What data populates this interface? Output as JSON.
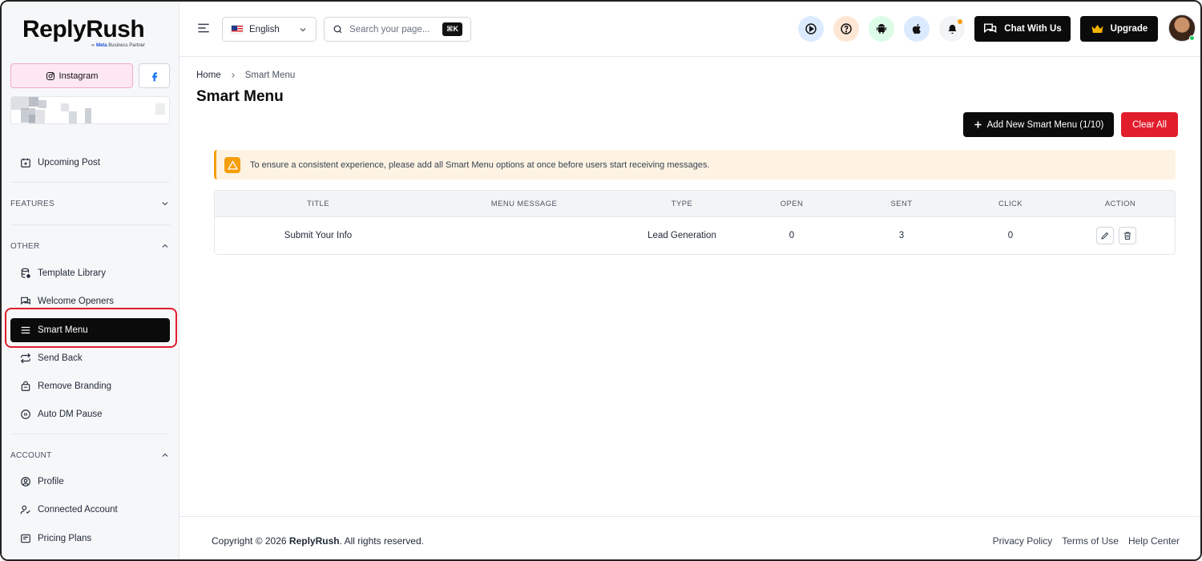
{
  "brand": {
    "name": "ReplyRush",
    "sub_prefix": "Meta",
    "sub_text": "Business Partner"
  },
  "sidebar": {
    "platforms": {
      "instagram": "Instagram",
      "facebook": "f"
    },
    "upcoming": "Upcoming Post",
    "sections": {
      "features": "FEATURES",
      "other": "OTHER",
      "account": "ACCOUNT"
    },
    "other_items": [
      {
        "label": "Template Library",
        "icon": "database-icon"
      },
      {
        "label": "Welcome Openers",
        "icon": "chat-icon"
      },
      {
        "label": "Smart Menu",
        "icon": "menu-icon",
        "active": true
      },
      {
        "label": "Send Back",
        "icon": "repeat-icon"
      },
      {
        "label": "Remove Branding",
        "icon": "bag-icon"
      },
      {
        "label": "Auto DM Pause",
        "icon": "pause-icon"
      }
    ],
    "account_items": [
      {
        "label": "Profile",
        "icon": "user-circle-icon"
      },
      {
        "label": "Connected Account",
        "icon": "user-check-icon"
      },
      {
        "label": "Pricing Plans",
        "icon": "tag-icon"
      }
    ]
  },
  "header": {
    "language": "English",
    "search_placeholder": "Search your page...",
    "search_shortcut": "⌘K",
    "chat_label": "Chat With Us",
    "upgrade_label": "Upgrade"
  },
  "main": {
    "breadcrumb": {
      "home": "Home",
      "current": "Smart Menu"
    },
    "title": "Smart Menu",
    "add_button": "Add New Smart Menu (1/10)",
    "clear_button": "Clear All",
    "alert": "To ensure a consistent experience, please add all Smart Menu options at once before users start receiving messages.",
    "table": {
      "columns": [
        "TITLE",
        "MENU MESSAGE",
        "TYPE",
        "OPEN",
        "SENT",
        "CLICK",
        "ACTION"
      ],
      "rows": [
        {
          "title": "Submit Your Info",
          "menu_message": "",
          "type": "Lead Generation",
          "open": "0",
          "sent": "3",
          "click": "0"
        }
      ]
    }
  },
  "footer": {
    "copyright_prefix": "Copyright © 2026 ",
    "copyright_brand": "ReplyRush",
    "copyright_suffix": ". All rights reserved.",
    "links": [
      "Privacy Policy",
      "Terms of Use",
      "Help Center"
    ]
  },
  "colors": {
    "accent": "#0b0b0b",
    "danger": "#e11d2c",
    "warning": "#f59e0b",
    "instagram_bg": "#fde8f2"
  }
}
